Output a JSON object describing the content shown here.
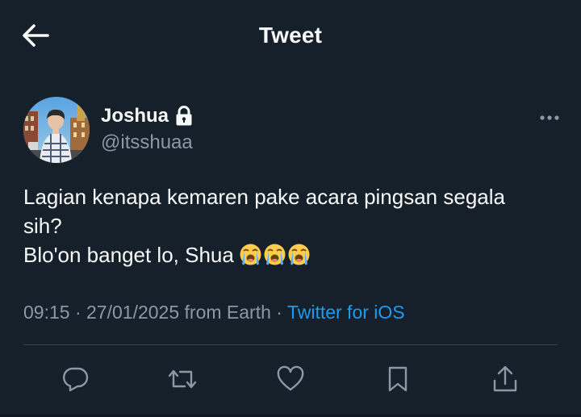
{
  "header": {
    "title": "Tweet",
    "back_icon": "arrow-left-icon"
  },
  "author": {
    "name": "Joshua",
    "handle": "@itsshuaa",
    "protected_icon": "lock-icon",
    "more_icon": "more-horizontal-icon"
  },
  "tweet": {
    "line1": "Lagian kenapa kemaren pake acara pingsan segala",
    "line2": "sih?",
    "line3": "Blo'on banget lo, Shua",
    "emojis": [
      "loudly-crying-face-emoji",
      "loudly-crying-face-emoji",
      "loudly-crying-face-emoji"
    ]
  },
  "meta": {
    "time": "09:15",
    "separator1": " · ",
    "date": "27/01/2025",
    "location": " from Earth",
    "separator2": " · ",
    "source": "Twitter for iOS"
  },
  "actions": [
    {
      "name": "reply",
      "icon": "reply-icon"
    },
    {
      "name": "retweet",
      "icon": "retweet-icon"
    },
    {
      "name": "like",
      "icon": "heart-icon"
    },
    {
      "name": "bookmark",
      "icon": "bookmark-icon"
    },
    {
      "name": "share",
      "icon": "share-icon"
    }
  ],
  "colors": {
    "background": "#15202b",
    "text": "#f7f9f9",
    "secondary": "#8b98a5",
    "accent": "#1d9bf0",
    "divider": "#38444d"
  }
}
